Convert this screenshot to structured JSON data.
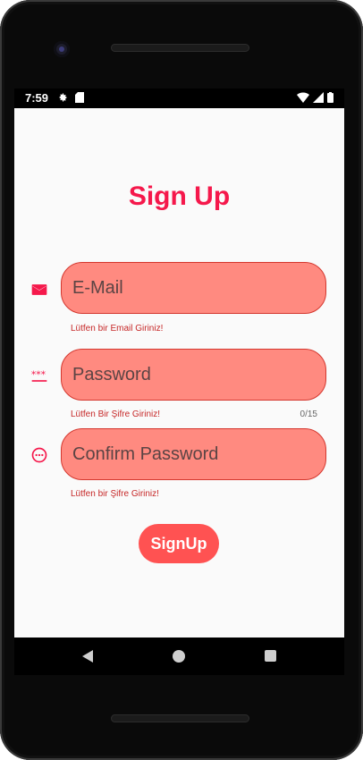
{
  "status_bar": {
    "time": "7:59"
  },
  "page": {
    "title": "Sign Up"
  },
  "email": {
    "placeholder": "E-Mail",
    "helper": "Lütfen bir Email Giriniz!"
  },
  "password": {
    "placeholder": "Password",
    "helper": "Lütfen Bir Şifre Giriniz!",
    "counter": "0/15"
  },
  "confirm_password": {
    "placeholder": "Confirm Password",
    "helper": "Lütfen bir Şifre Giriniz!"
  },
  "actions": {
    "signup_label": "SignUp"
  },
  "icons": {
    "email": "mail-icon",
    "password": "password-dots-icon",
    "confirm": "more-circle-icon",
    "settings": "gear-icon",
    "sd": "sd-card-icon",
    "wifi": "wifi-icon",
    "signal": "signal-icon",
    "battery": "battery-icon",
    "back": "back-icon",
    "home": "home-icon",
    "recents": "recents-icon"
  },
  "colors": {
    "accent": "#f5184b",
    "field_bg": "#ff8a80",
    "button_bg": "#ff5252",
    "error": "#c62828"
  }
}
